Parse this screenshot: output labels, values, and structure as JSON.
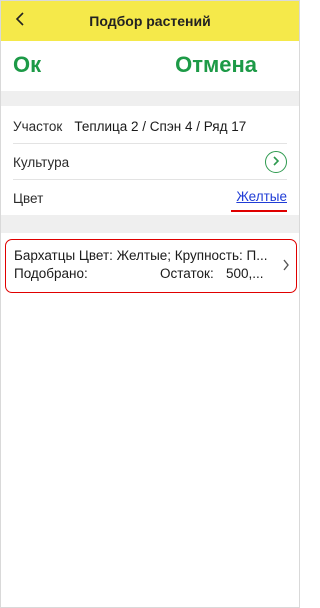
{
  "header": {
    "title": "Подбор растений",
    "back_icon": "chevron-left-icon",
    "background": "#f5e94a"
  },
  "actions": {
    "ok_label": "Ок",
    "cancel_label": "Отмена",
    "color": "#1d9a47"
  },
  "fields": {
    "plot": {
      "label": "Участок",
      "value": "Теплица 2 / Спэн 4 / Ряд 17"
    },
    "culture": {
      "label": "Культура",
      "value": "",
      "icon": "circle-chevron-right-icon"
    },
    "color": {
      "label": "Цвет",
      "value": "Желтые",
      "link_color": "#1f3cd6"
    }
  },
  "list": {
    "items": [
      {
        "title": "Бархатцы Цвет: Желтые; Крупность: П...",
        "picked_label": "Подобрано:",
        "picked_value": "",
        "remain_label": "Остаток:",
        "remain_value": "500,...",
        "icon": "chevron-right-icon"
      }
    ]
  },
  "highlight_color": "#e00000"
}
